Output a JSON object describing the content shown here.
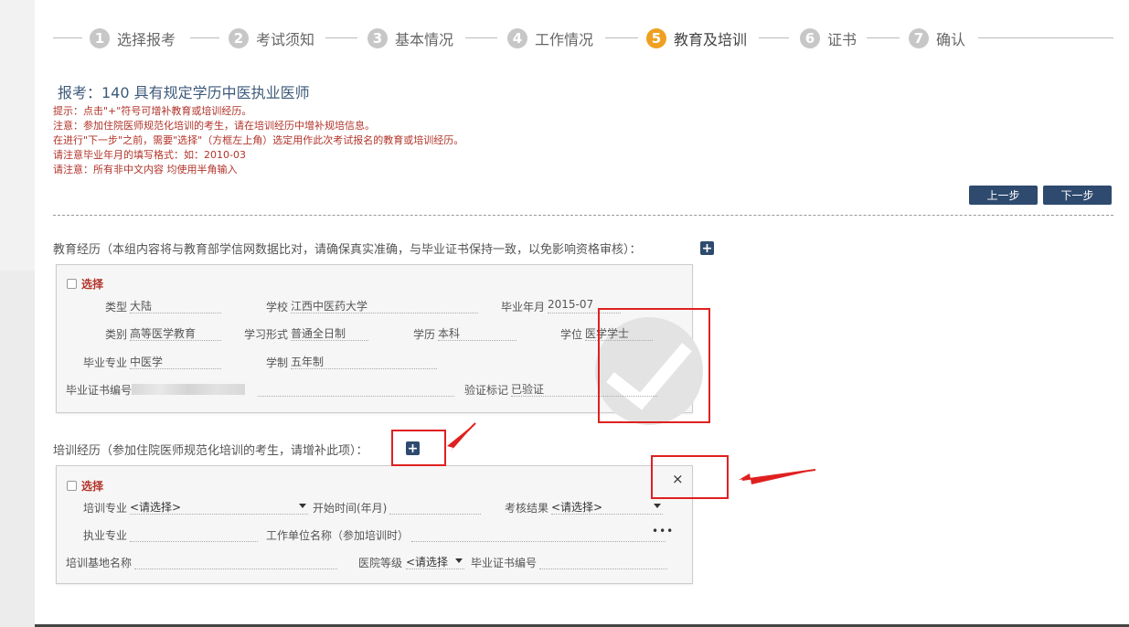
{
  "steps": [
    {
      "num": "1",
      "label": "选择报考"
    },
    {
      "num": "2",
      "label": "考试须知"
    },
    {
      "num": "3",
      "label": "基本情况"
    },
    {
      "num": "4",
      "label": "工作情况"
    },
    {
      "num": "5",
      "label": "教育及培训"
    },
    {
      "num": "6",
      "label": "证书"
    },
    {
      "num": "7",
      "label": "确认"
    }
  ],
  "active_step": 5,
  "colors": {
    "accent": "#f0a020",
    "button": "#2e4a6e",
    "note_red": "#b2342a",
    "highlight": "#e02020"
  },
  "title": "报考：140 具有规定学历中医执业医师",
  "notes": [
    "提示：点击\"+\"符号可增补教育或培训经历。",
    "注意：参加住院医师规范化培训的考生，请在培训经历中增补规培信息。",
    "在进行\"下一步\"之前，需要\"选择\"（方框左上角）选定用作此次考试报名的教育或培训经历。",
    "请注意毕业年月的填写格式：如：2010-03",
    "请注意：所有非中文内容 均使用半角输入"
  ],
  "buttons": {
    "prev": "上一步",
    "next": "下一步"
  },
  "education": {
    "section_title": "教育经历（本组内容将与教育部学信网数据比对，请确保真实准确，与毕业证书保持一致，以免影响资格审核）：",
    "add_icon": "+",
    "select_label": "选择",
    "fields": {
      "type_label": "类型",
      "type_value": "大陆",
      "school_label": "学校",
      "school_value": "江西中医药大学",
      "grad_date_label": "毕业年月",
      "grad_date_value": "2015-07",
      "category_label": "类别",
      "category_value": "高等医学教育",
      "study_form_label": "学习形式",
      "study_form_value": "普通全日制",
      "education_label": "学历",
      "education_value": "本科",
      "degree_label": "学位",
      "degree_value": "医学学士",
      "major_label": "毕业专业",
      "major_value": "中医学",
      "duration_label": "学制",
      "duration_value": "五年制",
      "cert_no_label": "毕业证书编号",
      "verify_label": "验证标记",
      "verify_value": "已验证"
    },
    "watermark_icon": "check-icon"
  },
  "training": {
    "section_title": "培训经历（参加住院医师规范化培训的考生，请增补此项）：",
    "add_icon": "+",
    "select_label": "选择",
    "close_icon": "×",
    "fields": {
      "training_major_label": "培训专业",
      "training_major_value": "<请选择>",
      "start_time_label": "开始时间(年月)",
      "assess_label": "考核结果",
      "assess_value": "<请选择>",
      "practice_major_label": "执业专业",
      "work_unit_label": "工作单位名称（参加培训时）",
      "more_icon": "•••",
      "base_name_label": "培训基地名称",
      "hospital_level_label": "医院等级",
      "hospital_level_value": "<请选择",
      "grad_cert_label": "毕业证书编号"
    }
  }
}
